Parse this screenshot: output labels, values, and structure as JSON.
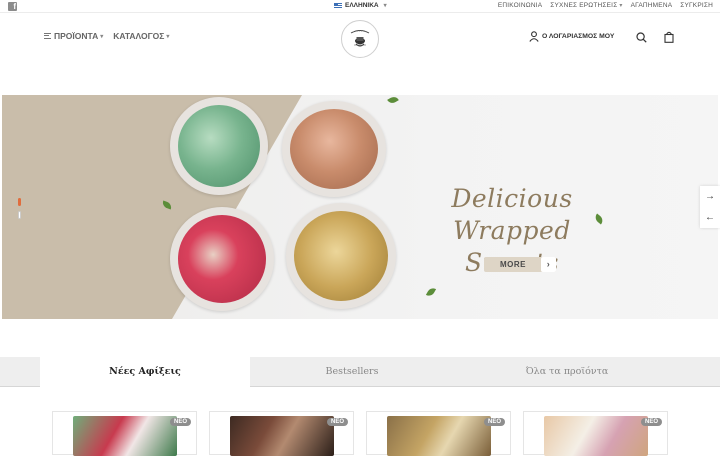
{
  "topbar": {
    "facebook_icon": "facebook-icon",
    "language": "ΕΛΛΗΝΙΚΑ",
    "links": [
      "ΕΠΙΚΟΙΝΩΝΙΑ",
      "ΣΥΧΝΕΣ ΕΡΩΤΗΣΕΙΣ",
      "ΑΓΑΠΗΜΕΝΑ",
      "ΣΥΓΚΡΙΣΗ"
    ]
  },
  "header": {
    "menu": [
      "ΠΡΟΪΟΝΤΑ",
      "ΚΑΤΑΛΟΓΟΣ"
    ],
    "account": "Ο ΛΟΓΑΡΙΑΣΜΟΣ ΜΟΥ",
    "icons": [
      "user-icon",
      "search-icon",
      "cart-icon"
    ]
  },
  "hero": {
    "title_line1": "Delicious Wrapped",
    "title_line2": "Sweets",
    "button": "MORE",
    "slides_total": 2,
    "active_slide": 1
  },
  "tabs": [
    "Νέες Αφίξεις",
    "Bestsellers",
    "Όλα τα προϊόντα"
  ],
  "products": [
    {
      "badge": "ΝΕΟ"
    },
    {
      "badge": "ΝΕΟ"
    },
    {
      "badge": "ΝΕΟ"
    },
    {
      "badge": "ΝΕΟ"
    }
  ],
  "colors": {
    "accent": "#e06d3d",
    "hero_text": "#8d7b5e",
    "beige": "#c9bdaa",
    "button_bg": "#ded5c6"
  }
}
